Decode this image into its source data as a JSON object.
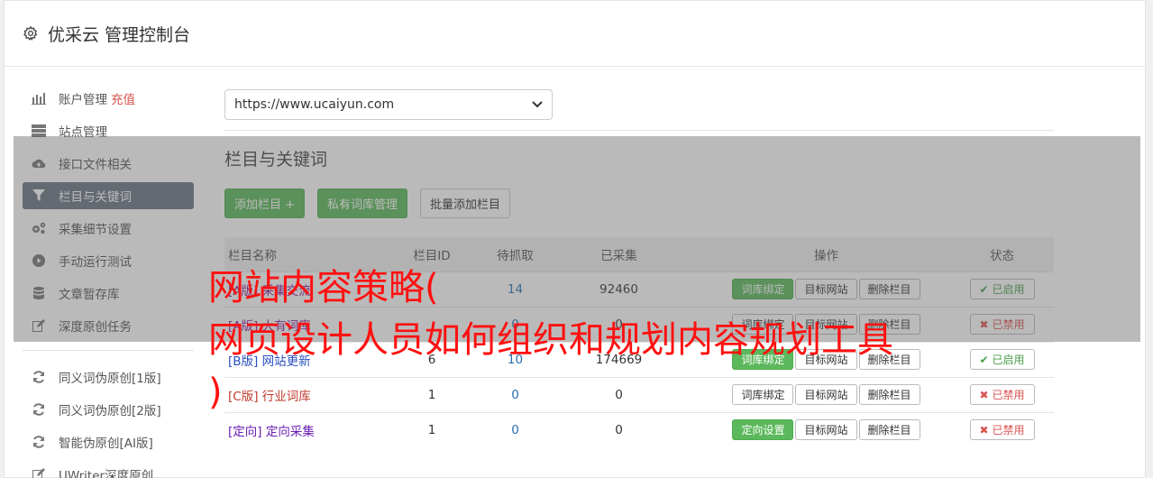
{
  "header": {
    "title": "优采云 管理控制台",
    "icon": "gear-icon"
  },
  "sidebar": {
    "items": [
      {
        "label": "账户管理",
        "extra": "充值",
        "icon": "bar-chart-icon"
      },
      {
        "label": "站点管理",
        "icon": "server-icon"
      },
      {
        "label": "接口文件相关",
        "icon": "cloud-upload-icon"
      },
      {
        "label": "栏目与关键词",
        "icon": "filter-icon",
        "active": true
      },
      {
        "label": "采集细节设置",
        "icon": "cogs-icon"
      },
      {
        "label": "手动运行测试",
        "icon": "play-circle-icon"
      },
      {
        "label": "文章暂存库",
        "icon": "database-icon"
      },
      {
        "label": "深度原创任务",
        "icon": "edit-icon"
      }
    ],
    "tools": [
      {
        "label": "同义词伪原创[1版]",
        "icon": "refresh-icon"
      },
      {
        "label": "同义词伪原创[2版]",
        "icon": "refresh-icon"
      },
      {
        "label": "智能伪原创[AI版]",
        "icon": "refresh-icon"
      },
      {
        "label": "UWriter深度原创",
        "icon": "edit-icon"
      }
    ]
  },
  "main": {
    "site_select": {
      "value": "https://www.ucaiyun.com"
    },
    "section_title": "栏目与关键词",
    "buttons": {
      "add_column": "添加栏目 +",
      "private_lib": "私有词库管理",
      "batch_add": "批量添加栏目"
    },
    "table": {
      "headers": {
        "name": "栏目名称",
        "id": "栏目ID",
        "pending": "待抓取",
        "collected": "已采集",
        "ops": "操作",
        "status": "状态"
      },
      "rows": [
        {
          "tag": "[A版]",
          "name": "采集交流",
          "id": "",
          "pending": "14",
          "collected": "92460",
          "op1": "词库绑定",
          "op2": "目标网站",
          "op3": "删除栏目",
          "status": "已启用"
        },
        {
          "tag": "[A版]",
          "name": "大有词库",
          "id": "",
          "pending": "0",
          "collected": "0",
          "op1": "词库绑定",
          "op2": "目标网站",
          "op3": "删除栏目",
          "status": "已禁用"
        },
        {
          "tag": "[B版]",
          "name": "网站更新",
          "id": "6",
          "pending": "10",
          "collected": "174669",
          "op1": "词库绑定",
          "op2": "目标网站",
          "op3": "删除栏目",
          "status": "已启用"
        },
        {
          "tag": "[C版]",
          "name": "行业词库",
          "id": "1",
          "pending": "0",
          "collected": "0",
          "op1": "词库绑定",
          "op2": "目标网站",
          "op3": "删除栏目",
          "status": "已禁用"
        },
        {
          "tag": "[定向]",
          "name": "定向采集",
          "id": "1",
          "pending": "0",
          "collected": "0",
          "op1": "定向设置",
          "op2": "目标网站",
          "op3": "删除栏目",
          "status": "已禁用"
        }
      ]
    }
  },
  "overlay": {
    "line1": "网站内容策略(",
    "line2": "网页设计人员如何组织和规划内容规划工具",
    "line3": ")"
  },
  "colors": {
    "accent_green": "#5cb85c",
    "active_sidebar": "#6b7683",
    "danger": "#d9534f",
    "overlay_text": "#ff1010"
  }
}
